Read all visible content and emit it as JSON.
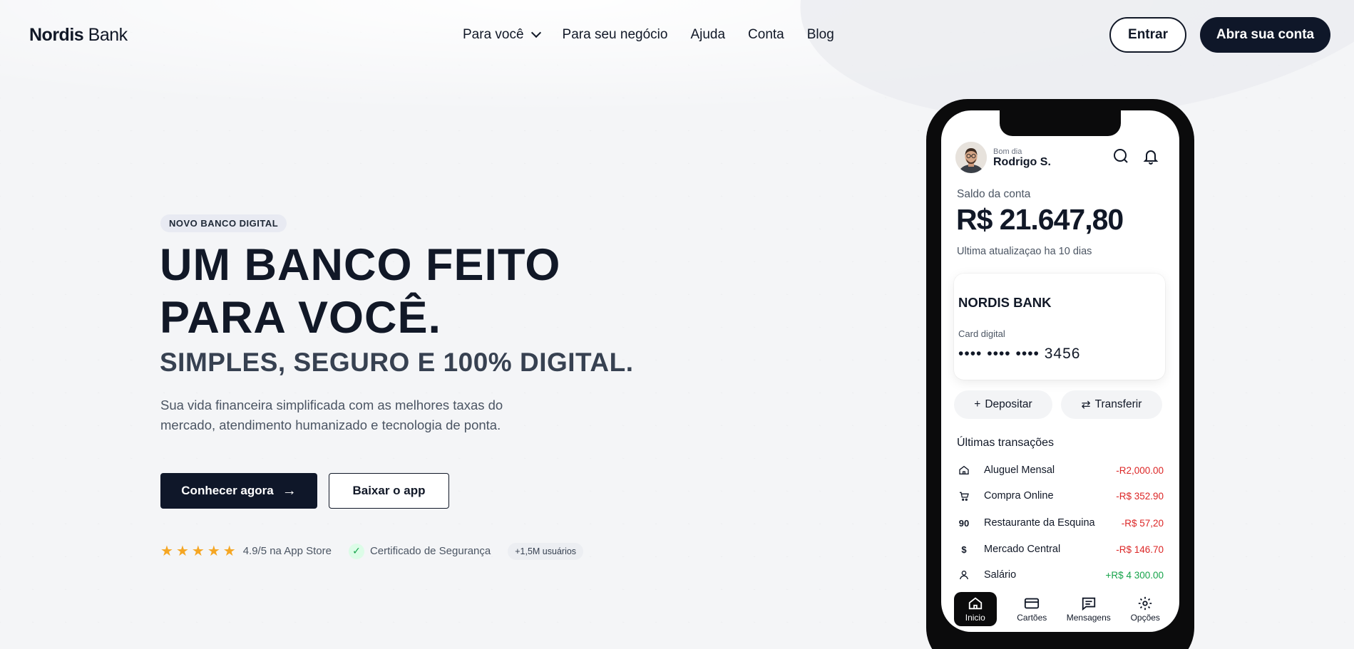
{
  "nav": {
    "logo_bold": "Nordis",
    "logo_light": "Bank",
    "menu": [
      {
        "label": "Para você"
      },
      {
        "label": "Para seu negócio"
      },
      {
        "label": "Ajuda"
      },
      {
        "label": "Conta"
      },
      {
        "label": "Blog"
      }
    ],
    "login_label": "Entrar",
    "signup_label": "Abra sua conta"
  },
  "hero": {
    "badge": "NOVO BANCO DIGITAL",
    "title_line1": "UM BANCO FEITO",
    "title_line2": "PARA VOCÊ.",
    "subtitle": "SIMPLES, SEGURO E 100% DIGITAL.",
    "description": "Sua vida financeira simplificada com as melhores taxas do mercado, atendimento humanizado e tecnologia de ponta.",
    "primary_cta": "Conhecer agora",
    "secondary_cta": "Baixar o app",
    "rating_text": "4.9/5 na App Store",
    "rating_stars": 5,
    "security_text": "Certificado de Segurança",
    "users_text": "+1,5M usuários"
  },
  "phone": {
    "greeting": "Bom dia",
    "user_name": "Rodrigo S.",
    "balance_label": "Saldo da conta",
    "balance_value": "R$ 21.647,80",
    "balance_updated": "Ultima atualizaçao ha 10 dias",
    "card": {
      "brand": "NORDIS BANK",
      "label": "Card digital",
      "number": "•••• ••••  •••• 3456"
    },
    "actions": {
      "deposit": "Depositar",
      "transfer": "Transferir"
    },
    "transactions_title": "Últimas transações",
    "transactions": [
      {
        "icon": "home-icon",
        "name": "Aluguel Mensal",
        "amount": "-R2,000.00",
        "positive": false
      },
      {
        "icon": "cart-icon",
        "name": "Compra Online",
        "amount": "-R$ 352.90",
        "positive": false
      },
      {
        "icon": "restaurant-icon",
        "glyph": "90",
        "name": "Restaurante da Esquina",
        "amount": "-R$ 57,20",
        "positive": false
      },
      {
        "icon": "dollar-icon",
        "glyph": "$",
        "name": "Mercado Central",
        "amount": "-R$ 146.70",
        "positive": false
      },
      {
        "icon": "person-icon",
        "name": "Salário",
        "amount": "+R$ 4 300.00",
        "positive": true
      }
    ],
    "tabs": [
      {
        "label": "Inicio",
        "icon": "home-icon",
        "active": true
      },
      {
        "label": "Cartões",
        "icon": "card-icon",
        "active": false
      },
      {
        "label": "Mensagens",
        "icon": "message-icon",
        "active": false
      },
      {
        "label": "Opções",
        "icon": "gear-icon",
        "active": false
      }
    ]
  },
  "colors": {
    "primary_dark": "#0f1729",
    "star": "#f5a623",
    "negative": "#dc2626",
    "positive": "#16a34a"
  }
}
